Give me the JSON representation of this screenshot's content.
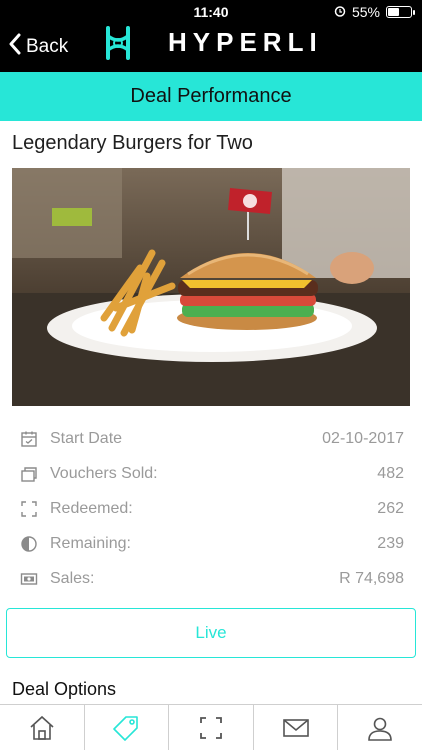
{
  "status_bar": {
    "time": "11:40",
    "battery": "55%",
    "battery_level": 0.55
  },
  "nav": {
    "back_label": "Back",
    "brand": "HYPERLI"
  },
  "banner": {
    "title": "Deal Performance"
  },
  "deal": {
    "title": "Legendary Burgers for Two",
    "stats": [
      {
        "label": "Start Date",
        "value": "02-10-2017",
        "icon": "calendar-icon"
      },
      {
        "label": "Vouchers Sold:",
        "value": "482",
        "icon": "vouchers-icon"
      },
      {
        "label": "Redeemed:",
        "value": "262",
        "icon": "scan-frame-icon"
      },
      {
        "label": "Remaining:",
        "value": "239",
        "icon": "pie-icon"
      },
      {
        "label": "Sales:",
        "value": "R 74,698",
        "icon": "cash-icon"
      }
    ],
    "status_button": "Live",
    "options_heading": "Deal Options"
  },
  "tabbar": {
    "tabs": [
      "home-icon",
      "tag-icon",
      "scan-icon",
      "mail-icon",
      "profile-icon"
    ]
  },
  "colors": {
    "accent": "#27e6d7",
    "header_bg": "#000000",
    "muted_text": "#9a9a9a"
  }
}
